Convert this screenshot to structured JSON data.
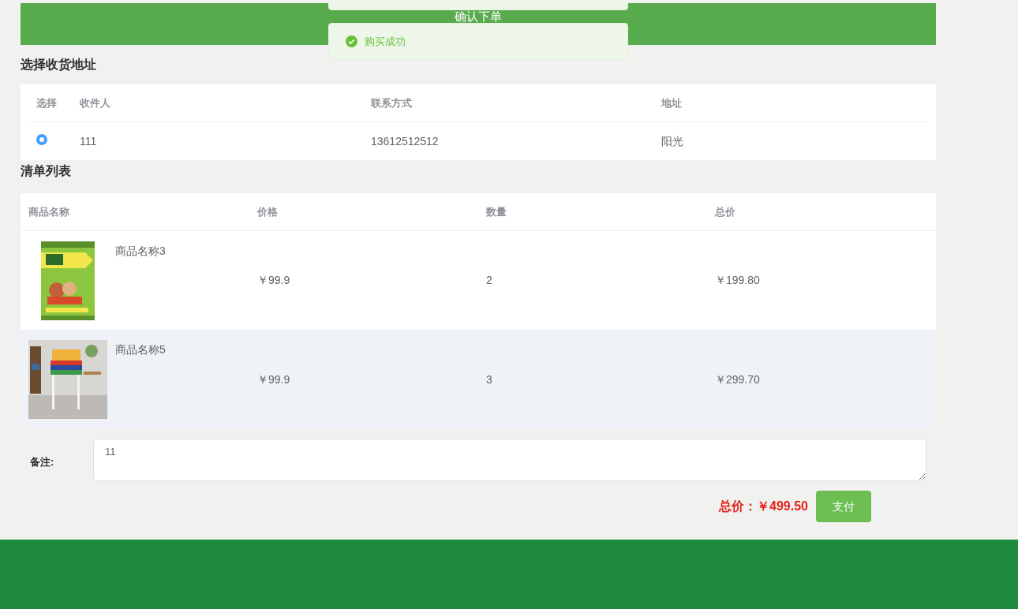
{
  "header": {
    "title": "确认下单"
  },
  "toast": {
    "kind": "success",
    "message": "购买成功"
  },
  "address_section": {
    "title": "选择收货地址",
    "columns": [
      "选择",
      "收件人",
      "联系方式",
      "地址"
    ],
    "rows": [
      {
        "selected": true,
        "recipient": "111",
        "phone": "13612512512",
        "address": "阳光"
      }
    ]
  },
  "list_section": {
    "title": "清单列表",
    "columns": [
      "商品名称",
      "价格",
      "数量",
      "总价"
    ],
    "rows": [
      {
        "name": "商品名称3",
        "price": "￥99.9",
        "quantity": "2",
        "total": "￥199.80",
        "hovered": false
      },
      {
        "name": "商品名称5",
        "price": "￥99.9",
        "quantity": "3",
        "total": "￥299.70",
        "hovered": true
      }
    ]
  },
  "remark": {
    "label": "备注:",
    "value": "11"
  },
  "total": {
    "label": "总价：",
    "amount": "￥499.50"
  },
  "pay_button": "支付"
}
